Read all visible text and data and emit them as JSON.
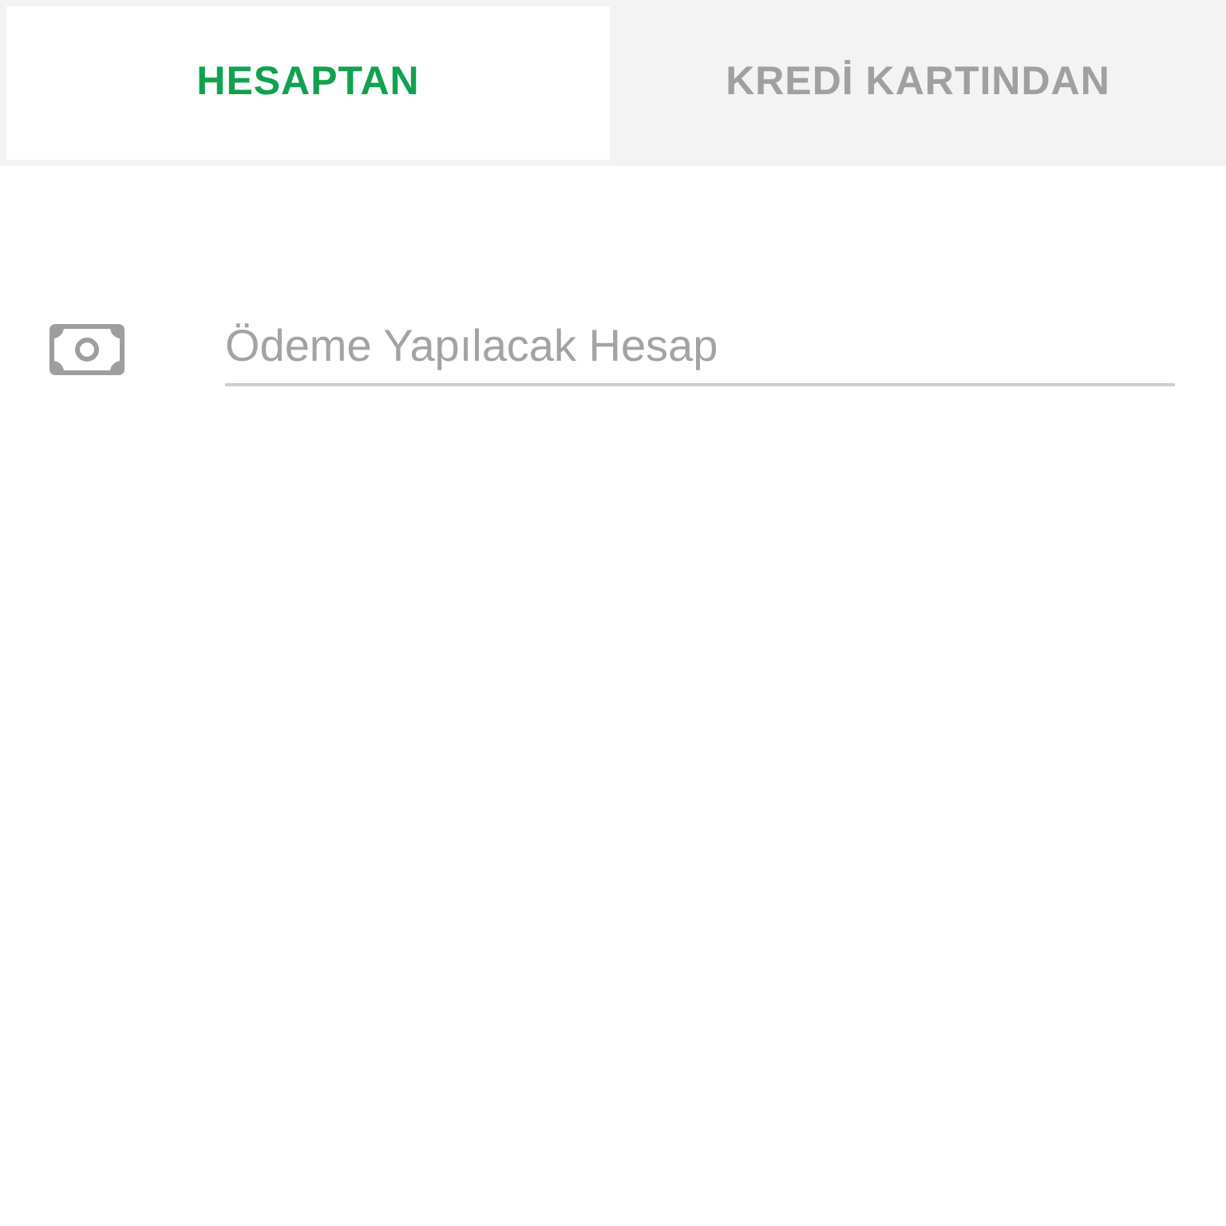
{
  "tabs": [
    {
      "label": "HESAPTAN",
      "selected": true
    },
    {
      "label": "KREDİ KARTINDAN",
      "selected": false
    }
  ],
  "account_field": {
    "placeholder": "Ödeme Yapılacak Hesap"
  }
}
